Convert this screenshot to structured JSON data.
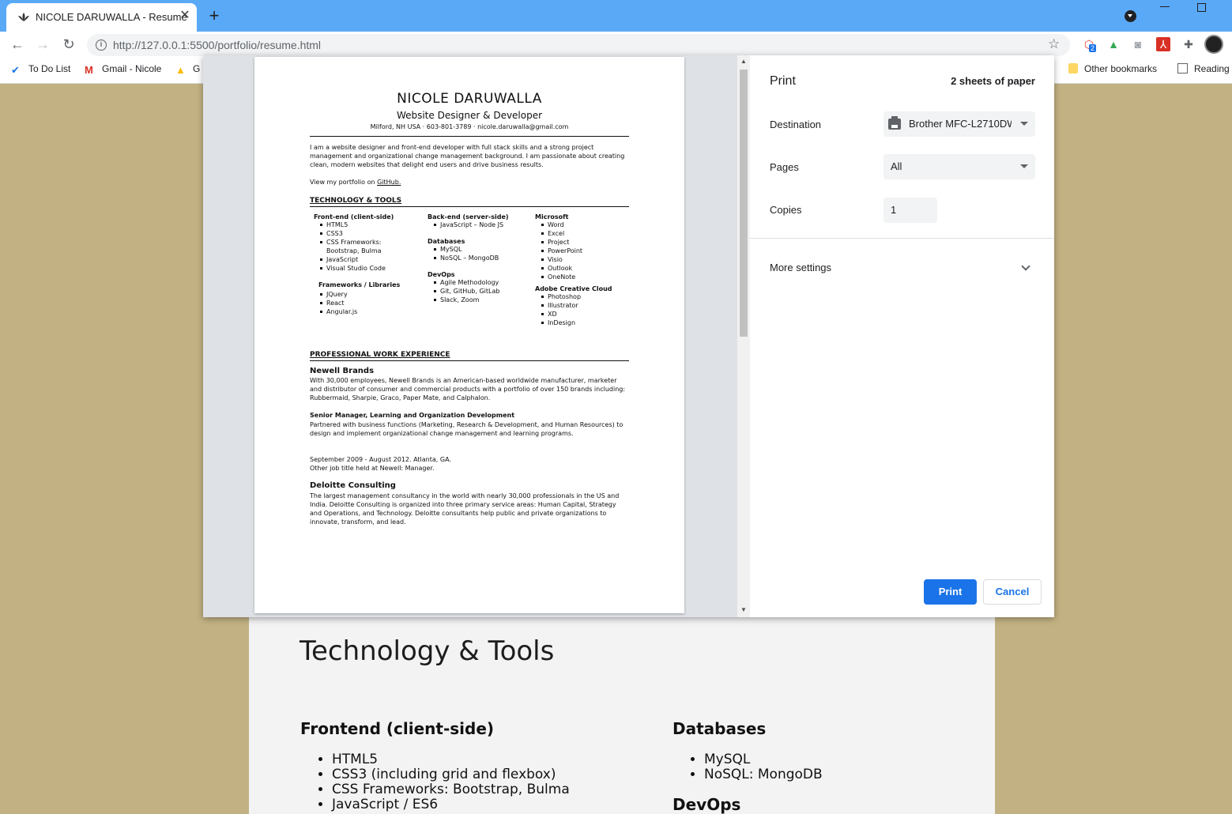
{
  "browser": {
    "tab_title": "NICOLE DARUWALLA - Resume",
    "tab_close": "✕",
    "new_tab": "+",
    "url": "http://127.0.0.1:5500/portfolio/resume.html",
    "extension_badge": "2",
    "bookmarks": [
      "To Do List",
      "Gmail - Nicole",
      "G",
      "Other bookmarks",
      "Reading"
    ]
  },
  "page": {
    "heading": "Technology & Tools",
    "frontend": {
      "title": "Frontend (client-side)",
      "items": [
        "HTML5",
        "CSS3 (including grid and flexbox)",
        "CSS Frameworks: Bootstrap, Bulma",
        "JavaScript / ES6"
      ]
    },
    "databases": {
      "title": "Databases",
      "items": [
        "MySQL",
        "NoSQL: MongoDB"
      ]
    },
    "devops_title": "DevOps"
  },
  "print": {
    "title": "Print",
    "sheets": "2 sheets of paper",
    "destination_label": "Destination",
    "destination_value": "Brother MFC-L2710DW",
    "pages_label": "Pages",
    "pages_value": "All",
    "copies_label": "Copies",
    "copies_value": "1",
    "more_settings": "More settings",
    "print_button": "Print",
    "cancel_button": "Cancel"
  },
  "resume": {
    "name": "NICOLE DARUWALLA",
    "role": "Website Designer & Developer",
    "contact": "Milford, NH USA · 603-801-3789 · nicole.daruwalla@gmail.com",
    "summary": "I am a website designer and front-end developer with full stack skills and a strong project management and organizational change management background. I am passionate about creating clean, modern websites that delight end users and drive business results.",
    "portfolio_text": "View my portfolio on",
    "portfolio_link": "GitHub.",
    "tech_heading": "TECHNOLOGY & TOOLS",
    "col1": {
      "frontend_title": "Front-end (client-side)",
      "frontend_items": [
        "HTML5",
        "CSS3",
        "CSS Frameworks:",
        "Bootstrap, Bulma",
        "JavaScript",
        "Visual Studio Code"
      ],
      "frameworks_title": "Frameworks / Libraries",
      "frameworks_items": [
        "JQuery",
        "React",
        "Angular.js"
      ]
    },
    "col2": {
      "backend_title": "Back-end (server-side)",
      "backend_items": [
        "JavaScript – Node JS"
      ],
      "databases_title": "Databases",
      "databases_items": [
        "MySQL",
        "NoSQL – MongoDB"
      ],
      "devops_title": "DevOps",
      "devops_items": [
        "Agile Methodology",
        "Git, GitHub, GitLab",
        "Slack, Zoom"
      ]
    },
    "col3": {
      "microsoft_title": "Microsoft",
      "microsoft_items": [
        "Word",
        "Excel",
        "Project",
        "PowerPoint",
        "Visio",
        "Outlook",
        "OneNote"
      ],
      "adobe_title": "Adobe Creative Cloud",
      "adobe_items": [
        "Photoshop",
        "Illustrator",
        "XD",
        "InDesign"
      ]
    },
    "work_heading": "PROFESSIONAL WORK EXPERIENCE",
    "newell_title": "Newell Brands",
    "newell_desc": "With 30,000 employees, Newell Brands is an American-based worldwide manufacturer, marketer and distributor of consumer and commercial products with a portfolio of over 150 brands including: Rubbermaid, Sharpie, Graco, Paper Mate, and Calphalon.",
    "newell_job": "Senior Manager, Learning and Organization Development",
    "newell_job_desc": "Partnered with business functions (Marketing, Research & Development, and Human Resources) to design and implement organizational change management and learning programs.",
    "newell_dates": "September 2009 - August 2012. Atlanta, GA.",
    "newell_other": "Other job title held at Newell: Manager.",
    "deloitte_title": "Deloitte Consulting",
    "deloitte_desc": "The largest management consultancy in the world with nearly 30,000 professionals in the US and India. Deloitte Consulting is organized into three primary service areas: Human Capital, Strategy and Operations, and Technology. Deloitte consultants help public and private organizations to innovate, transform, and lead."
  },
  "colors": {
    "tabbar": "#5aa9f7",
    "page_bg": "#c2b283",
    "accent": "#1a73e8"
  }
}
